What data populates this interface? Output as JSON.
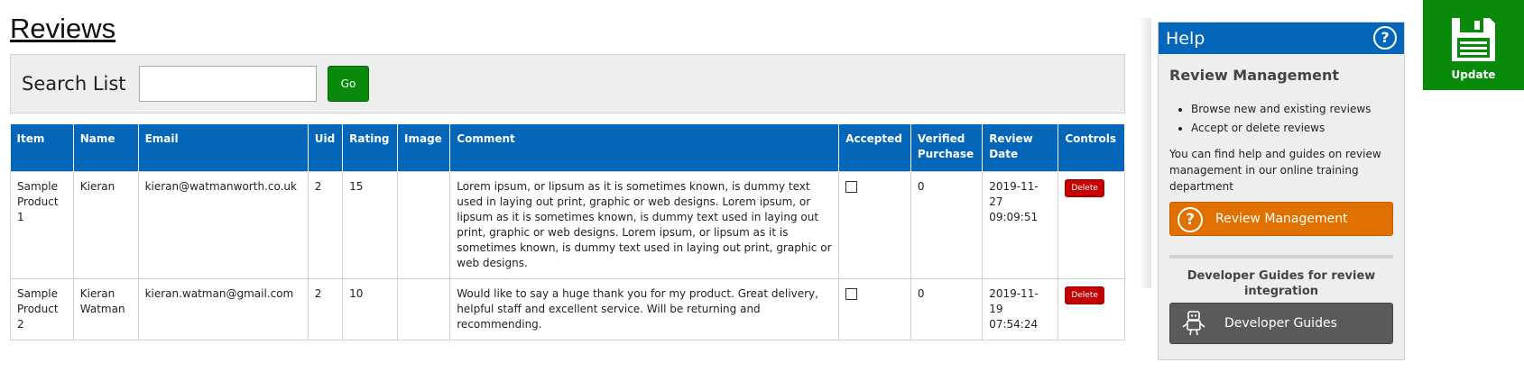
{
  "page": {
    "title": "Reviews"
  },
  "search": {
    "label": "Search List",
    "value": "",
    "placeholder": "",
    "go_label": "Go"
  },
  "table": {
    "columns": [
      "Item",
      "Name",
      "Email",
      "Uid",
      "Rating",
      "Image",
      "Comment",
      "Accepted",
      "Verified Purchase",
      "Review Date",
      "Controls"
    ],
    "rows": [
      {
        "item": "Sample Product 1",
        "name": "Kieran",
        "email": "kieran@watmanworth.co.uk",
        "uid": "2",
        "rating": "15",
        "image": "",
        "comment": "Lorem ipsum, or lipsum as it is sometimes known, is dummy text used in laying out print, graphic or web designs. Lorem ipsum, or lipsum as it is sometimes known, is dummy text used in laying out print, graphic or web designs. Lorem ipsum, or lipsum as it is sometimes known, is dummy text used in laying out print, graphic or web designs.",
        "accepted": false,
        "verified": "0",
        "date": "2019-11-27 09:09:51",
        "delete_label": "Delete"
      },
      {
        "item": "Sample Product 2",
        "name": "Kieran Watman",
        "email": "kieran.watman@gmail.com",
        "uid": "2",
        "rating": "10",
        "image": "",
        "comment": "Would like to say a huge thank you for my product. Great delivery, helpful staff and excellent service. Will be returning and recommending.",
        "accepted": false,
        "verified": "0",
        "date": "2019-11-19 07:54:24",
        "delete_label": "Delete"
      }
    ]
  },
  "help": {
    "title": "Help",
    "section_title": "Review Management",
    "bullets": [
      "Browse new and existing reviews",
      "Accept or delete reviews"
    ],
    "text": "You can find help and guides on review management in our online training department",
    "review_button_label": "Review Management",
    "dev_title": "Developer Guides for review integration",
    "dev_button_label": "Developer Guides"
  },
  "update": {
    "label": "Update"
  },
  "colors": {
    "header_blue": "#0466b8",
    "green": "#0a8a0a",
    "orange": "#e07000",
    "delete_red": "#c40000",
    "grey_button": "#5a5a5a"
  }
}
